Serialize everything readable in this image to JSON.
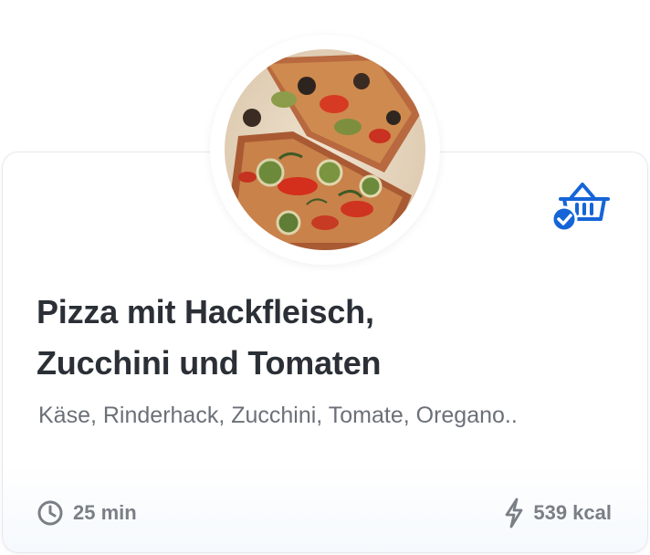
{
  "recipe": {
    "title_line1": "Pizza mit Hackfleisch,",
    "title_line2": "Zucchini und Tomaten",
    "ingredients": "Käse, Rinderhack, Zucchini, Tomate, Oregano..",
    "image_icon": "pizza-photo",
    "basket_icon": "shopping-basket-check-icon"
  },
  "meta": {
    "time": "25 min",
    "time_icon": "clock-icon",
    "kcal": "539 kcal",
    "kcal_icon": "lightning-bolt-icon"
  },
  "colors": {
    "accent": "#1565d8",
    "title": "#2b2f36",
    "muted": "#6b7078",
    "meta": "#7a7f86"
  }
}
